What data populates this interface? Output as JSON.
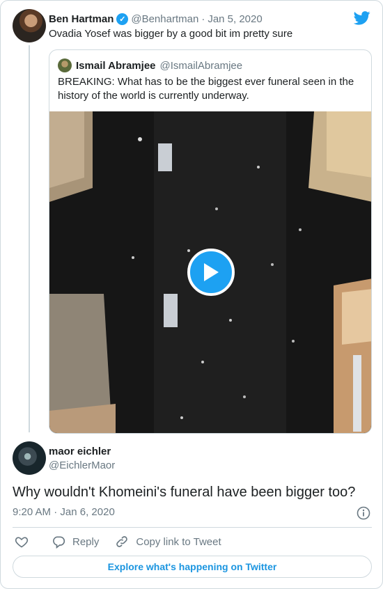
{
  "tweet": {
    "author_name": "Ben Hartman",
    "author_handle": "@Benhartman",
    "date": "Jan 5, 2020",
    "separator": "·",
    "text": "Ovadia Yosef was bigger by a good bit im pretty sure",
    "verified_icon": "verified-badge-icon",
    "logo_icon": "twitter-bird-icon"
  },
  "quoted": {
    "author_name": "Ismail Abramjee",
    "author_handle": "@IsmailAbramjee",
    "text": "BREAKING: What has to be the biggest ever funeral seen in the history of the world is currently underway.",
    "media_icon": "play-icon"
  },
  "reply": {
    "author_name": "maor eichler",
    "author_handle": "@EichlerMaor",
    "text": "Why wouldn't Khomeini's funeral have been bigger too?",
    "time": "9:20 AM",
    "separator": "·",
    "date": "Jan 6, 2020",
    "info_icon": "info-icon"
  },
  "actions": {
    "like_icon": "heart-icon",
    "reply_label": "Reply",
    "copy_label": "Copy link to Tweet"
  },
  "footer": {
    "explore_label": "Explore what's happening on Twitter"
  },
  "colors": {
    "accent": "#1da1f2",
    "link": "#1b95e0",
    "muted": "#697882",
    "border": "#cfd9de"
  }
}
